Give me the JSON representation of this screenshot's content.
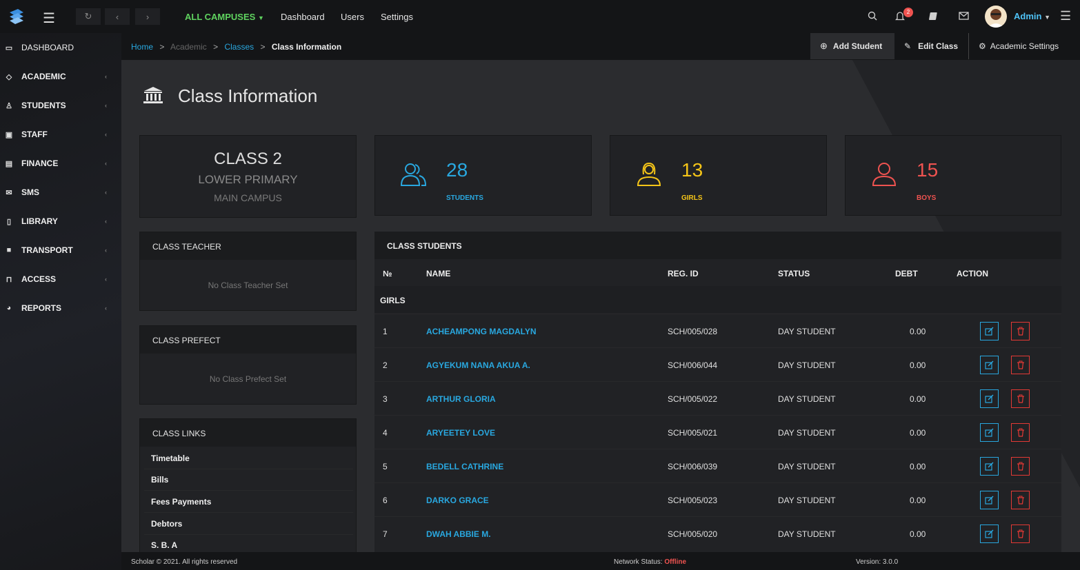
{
  "topbar": {
    "campus": "ALL CAMPUSES",
    "links": [
      "Dashboard",
      "Users",
      "Settings"
    ],
    "notification_count": "2",
    "user": "Admin"
  },
  "sidebar": {
    "items": [
      {
        "label": "DASHBOARD",
        "icon": "monitor-icon"
      },
      {
        "label": "ACADEMIC",
        "icon": "graduation-cap-icon"
      },
      {
        "label": "STUDENTS",
        "icon": "user-icon"
      },
      {
        "label": "STAFF",
        "icon": "briefcase-icon"
      },
      {
        "label": "FINANCE",
        "icon": "money-icon"
      },
      {
        "label": "SMS",
        "icon": "envelope-icon"
      },
      {
        "label": "LIBRARY",
        "icon": "book-icon"
      },
      {
        "label": "TRANSPORT",
        "icon": "truck-icon"
      },
      {
        "label": "ACCESS",
        "icon": "lock-icon"
      },
      {
        "label": "REPORTS",
        "icon": "pie-chart-icon"
      }
    ]
  },
  "breadcrumb": {
    "home": "Home",
    "academic": "Academic",
    "classes": "Classes",
    "current": "Class Information",
    "sep": ">"
  },
  "actions": {
    "add_student": "Add Student",
    "edit_class": "Edit Class",
    "academic_settings": "Academic Settings"
  },
  "page_title": "Class Information",
  "class_card": {
    "name": "CLASS 2",
    "level": "LOWER PRIMARY",
    "campus": "MAIN CAMPUS"
  },
  "stats": {
    "students": {
      "value": "28",
      "label": "STUDENTS",
      "color": "#29a8e0"
    },
    "girls": {
      "value": "13",
      "label": "GIRLS",
      "color": "#f5c518"
    },
    "boys": {
      "value": "15",
      "label": "BOYS",
      "color": "#ef5350"
    }
  },
  "teacher_panel": {
    "title": "CLASS TEACHER",
    "empty": "No Class Teacher Set"
  },
  "prefect_panel": {
    "title": "CLASS PREFECT",
    "empty": "No Class Prefect Set"
  },
  "links_panel": {
    "title": "CLASS LINKS",
    "links": [
      "Timetable",
      "Bills",
      "Fees Payments",
      "Debtors",
      "S. B. A"
    ]
  },
  "students_table": {
    "title": "CLASS STUDENTS",
    "columns": [
      "№",
      "NAME",
      "REG. ID",
      "STATUS",
      "DEBT",
      "ACTION"
    ],
    "group": "GIRLS",
    "rows": [
      {
        "no": "1",
        "name": "ACHEAMPONG MAGDALYN",
        "reg": "SCH/005/028",
        "status": "DAY STUDENT",
        "debt": "0.00"
      },
      {
        "no": "2",
        "name": "AGYEKUM NANA AKUA A.",
        "reg": "SCH/006/044",
        "status": "DAY STUDENT",
        "debt": "0.00"
      },
      {
        "no": "3",
        "name": "ARTHUR GLORIA",
        "reg": "SCH/005/022",
        "status": "DAY STUDENT",
        "debt": "0.00"
      },
      {
        "no": "4",
        "name": "ARYEETEY LOVE",
        "reg": "SCH/005/021",
        "status": "DAY STUDENT",
        "debt": "0.00"
      },
      {
        "no": "5",
        "name": "BEDELL CATHRINE",
        "reg": "SCH/006/039",
        "status": "DAY STUDENT",
        "debt": "0.00"
      },
      {
        "no": "6",
        "name": "DARKO GRACE",
        "reg": "SCH/005/023",
        "status": "DAY STUDENT",
        "debt": "0.00"
      },
      {
        "no": "7",
        "name": "DWAH ABBIE M.",
        "reg": "SCH/005/020",
        "status": "DAY STUDENT",
        "debt": "0.00"
      }
    ]
  },
  "footer": {
    "copyright": "Scholar © 2021. All rights reserved",
    "network_label": "Network Status:",
    "network_status": "Offline",
    "version": "Version: 3.0.0"
  }
}
